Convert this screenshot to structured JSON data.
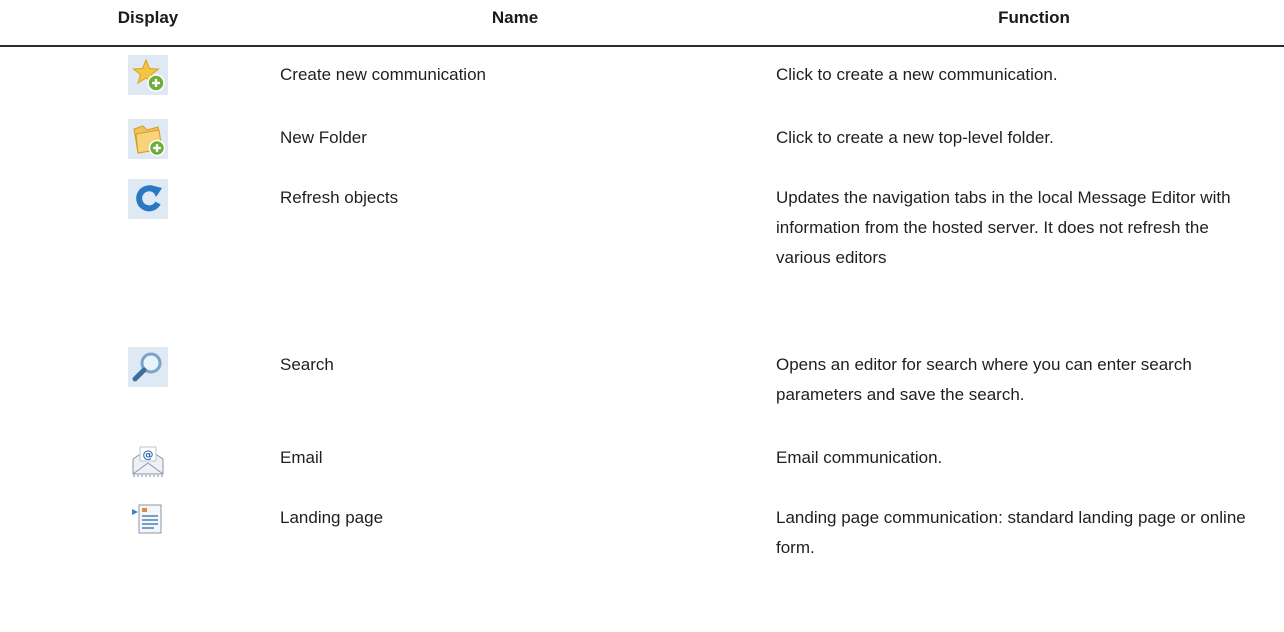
{
  "table": {
    "headers": {
      "display": "Display",
      "name": "Name",
      "function": "Function"
    },
    "rows": [
      {
        "icon": "create-communication-star-icon",
        "name": "Create new communication",
        "function": "Click to create a new communication."
      },
      {
        "icon": "new-folder-icon",
        "name": "New Folder",
        "function": "Click to create a new top-level folder."
      },
      {
        "icon": "refresh-icon",
        "name": "Refresh objects",
        "function": "Updates the navigation tabs in the local Message Editor with information from the hosted server. It does not refresh the various editors"
      },
      {
        "icon": "search-magnifier-icon",
        "name": "Search",
        "function": "Opens an editor for search where you can enter search parameters and save the search."
      },
      {
        "icon": "email-envelope-icon",
        "name": "Email",
        "function": "Email communication."
      },
      {
        "icon": "landing-page-icon",
        "name": "Landing page",
        "function": "Landing page communication: standard landing page or online form."
      }
    ]
  }
}
